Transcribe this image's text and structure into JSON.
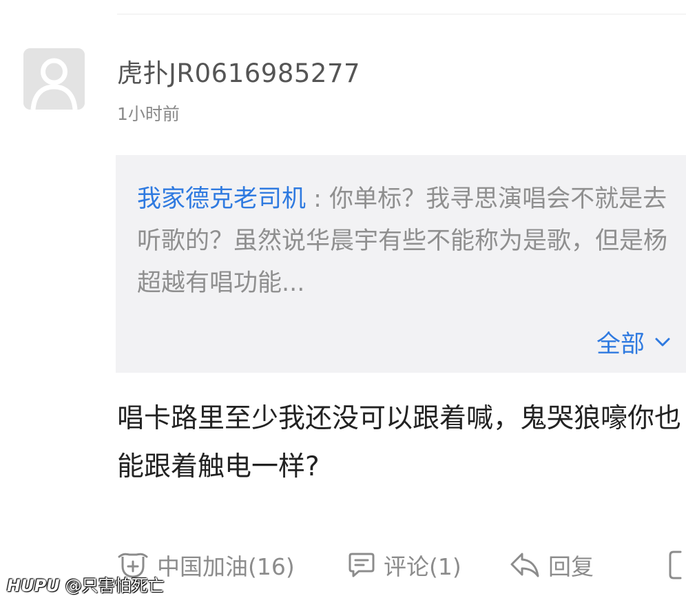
{
  "comment": {
    "username": "虎扑JR0616985277",
    "timestamp": "1小时前",
    "quote": {
      "author": "我家德克老司机",
      "separator": " : ",
      "text": "你单标？我寻思演唱会不就是去听歌的？虽然说华晨宇有些不能称为是歌，但是杨超越有唱功能...",
      "expand_label": "全部"
    },
    "body": "唱卡路里至少我还没可以跟着喊，鬼哭狼嚎你也能跟着触电一样?"
  },
  "actions": {
    "like_label": "中国加油(16)",
    "comment_label": "评论(1)",
    "reply_label": "回复"
  },
  "watermark": {
    "brand": "HUPU",
    "handle": "@只害怕死亡"
  },
  "colors": {
    "link": "#2f7ae0",
    "quote_bg": "#f2f2f4",
    "muted_text": "#8c8c8c",
    "body_text": "#222222"
  },
  "icons": {
    "avatar": "default-user-icon",
    "expand": "chevron-down-icon",
    "like": "mask-face-icon",
    "comment": "speech-bubble-icon",
    "reply": "reply-arrow-icon",
    "more": "bracket-icon"
  }
}
